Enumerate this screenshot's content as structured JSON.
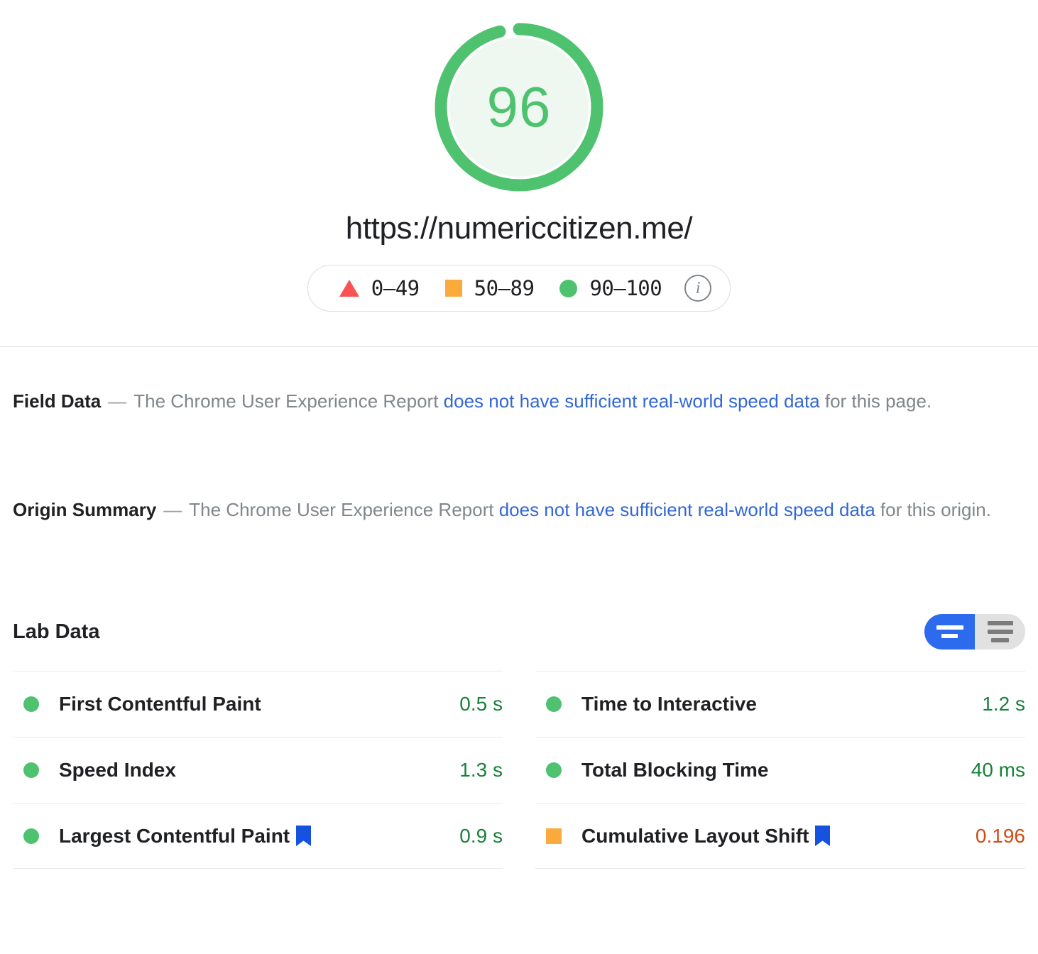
{
  "score": {
    "value": "96",
    "percent": 96,
    "color": "#4ec26f",
    "track_color": "#eef8f1",
    "aria_name": "performance-score-gauge"
  },
  "page_url": "https://numericcitizen.me/",
  "legend": {
    "items": [
      {
        "marker": "triangle-icon",
        "label": "0–49",
        "color": "#fa5252"
      },
      {
        "marker": "square-icon",
        "label": "50–89",
        "color": "#fbab3b"
      },
      {
        "marker": "circle-icon",
        "label": "90–100",
        "color": "#4ec26f"
      }
    ],
    "info_icon": "i",
    "info_icon_name": "info-icon"
  },
  "field_data": {
    "title": "Field Data",
    "dash": "—",
    "text_before": "The Chrome User Experience Report ",
    "link": "does not have sufficient real-world speed data",
    "text_after": " for this page."
  },
  "origin_summary": {
    "title": "Origin Summary",
    "dash": "—",
    "text_before": "The Chrome User Experience Report ",
    "link": "does not have sufficient real-world speed data",
    "text_after": " for this origin."
  },
  "lab_data": {
    "title": "Lab Data",
    "view_toggle": {
      "active_view": "compact-view",
      "inactive_view": "expanded-view",
      "active_color": "#2c6bee",
      "inactive_color": "#e1e1e1"
    },
    "columns": [
      {
        "metrics": [
          {
            "status": "green",
            "name": "First Contentful Paint",
            "value": "0.5 s",
            "value_color": "green",
            "bookmark": false
          },
          {
            "status": "green",
            "name": "Speed Index",
            "value": "1.3 s",
            "value_color": "green",
            "bookmark": false
          },
          {
            "status": "green",
            "name": "Largest Contentful Paint",
            "value": "0.9 s",
            "value_color": "green",
            "bookmark": true
          }
        ]
      },
      {
        "metrics": [
          {
            "status": "green",
            "name": "Time to Interactive",
            "value": "1.2 s",
            "value_color": "green",
            "bookmark": false
          },
          {
            "status": "green",
            "name": "Total Blocking Time",
            "value": "40 ms",
            "value_color": "green",
            "bookmark": false
          },
          {
            "status": "orange",
            "name": "Cumulative Layout Shift",
            "value": "0.196",
            "value_color": "orange",
            "bookmark": true
          }
        ]
      }
    ]
  }
}
